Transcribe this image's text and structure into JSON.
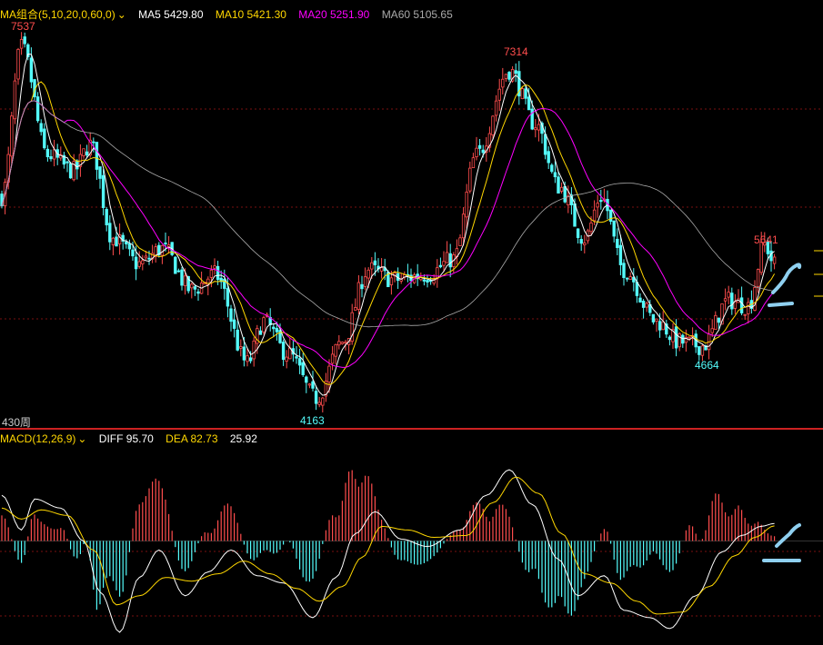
{
  "main_panel": {
    "ma_group_label": "MA组合(5,10,20,0,60,0)",
    "ma5_label": "MA5 5429.80",
    "ma10_label": "MA10 5421.30",
    "ma20_label": "MA20 5251.90",
    "ma60_label": "MA60 5105.65",
    "period_label": "430周",
    "annotations": {
      "high1": "7537",
      "low1": "4163",
      "high2": "7314",
      "low2": "4664",
      "recent_high": "5641"
    }
  },
  "macd_panel": {
    "macd_label": "MACD(12,26,9)",
    "diff_label": "DIFF 95.70",
    "dea_label": "DEA 82.73",
    "macd_value": "25.92"
  },
  "colors": {
    "ma5": "#ffffff",
    "ma10": "#ffd700",
    "ma20": "#ff00ff",
    "ma60": "#aaaaaa",
    "up": "#ff4d4d",
    "down": "#54fcfc",
    "annot_high": "#ff4d4d",
    "annot_low": "#54fcfc",
    "grid": "#7a1010",
    "freehand": "#8fd0f0"
  },
  "chart_data": {
    "type": "candlestick",
    "price_range": [
      4163,
      7537
    ],
    "anchors": [
      [
        0,
        6100
      ],
      [
        6,
        7537
      ],
      [
        14,
        6500
      ],
      [
        22,
        6350
      ],
      [
        27,
        6600
      ],
      [
        34,
        5700
      ],
      [
        42,
        5450
      ],
      [
        49,
        5600
      ],
      [
        58,
        5200
      ],
      [
        65,
        5350
      ],
      [
        75,
        4500
      ],
      [
        80,
        4900
      ],
      [
        87,
        4600
      ],
      [
        96,
        4163
      ],
      [
        104,
        4700
      ],
      [
        112,
        5400
      ],
      [
        120,
        5300
      ],
      [
        130,
        5350
      ],
      [
        138,
        5500
      ],
      [
        145,
        6500
      ],
      [
        155,
        7314
      ],
      [
        163,
        6800
      ],
      [
        170,
        6200
      ],
      [
        178,
        5700
      ],
      [
        183,
        6100
      ],
      [
        190,
        5400
      ],
      [
        200,
        4900
      ],
      [
        207,
        4700
      ],
      [
        214,
        4664
      ],
      [
        222,
        5100
      ],
      [
        228,
        5050
      ],
      [
        233,
        5641
      ],
      [
        236,
        5450
      ]
    ],
    "macd": {
      "diff": [
        [
          0,
          250
        ],
        [
          6,
          60
        ],
        [
          10,
          230
        ],
        [
          18,
          180
        ],
        [
          25,
          0
        ],
        [
          30,
          -280
        ],
        [
          36,
          -500
        ],
        [
          42,
          -200
        ],
        [
          48,
          -50
        ],
        [
          56,
          -300
        ],
        [
          63,
          -170
        ],
        [
          70,
          -50
        ],
        [
          78,
          -190
        ],
        [
          86,
          -230
        ],
        [
          95,
          -420
        ],
        [
          102,
          -200
        ],
        [
          108,
          40
        ],
        [
          114,
          160
        ],
        [
          122,
          10
        ],
        [
          130,
          -30
        ],
        [
          140,
          60
        ],
        [
          148,
          250
        ],
        [
          155,
          390
        ],
        [
          162,
          200
        ],
        [
          170,
          -100
        ],
        [
          176,
          -300
        ],
        [
          184,
          -190
        ],
        [
          190,
          -380
        ],
        [
          198,
          -420
        ],
        [
          204,
          -480
        ],
        [
          212,
          -300
        ],
        [
          220,
          -60
        ],
        [
          226,
          30
        ],
        [
          232,
          80
        ],
        [
          236,
          95.7
        ]
      ],
      "dea": [
        [
          0,
          180
        ],
        [
          6,
          120
        ],
        [
          12,
          170
        ],
        [
          20,
          140
        ],
        [
          28,
          -50
        ],
        [
          35,
          -350
        ],
        [
          42,
          -300
        ],
        [
          50,
          -200
        ],
        [
          58,
          -220
        ],
        [
          66,
          -180
        ],
        [
          74,
          -110
        ],
        [
          82,
          -180
        ],
        [
          90,
          -260
        ],
        [
          97,
          -330
        ],
        [
          104,
          -250
        ],
        [
          110,
          -90
        ],
        [
          116,
          80
        ],
        [
          124,
          60
        ],
        [
          132,
          20
        ],
        [
          142,
          30
        ],
        [
          150,
          210
        ],
        [
          157,
          350
        ],
        [
          164,
          260
        ],
        [
          171,
          40
        ],
        [
          178,
          -180
        ],
        [
          186,
          -230
        ],
        [
          194,
          -330
        ],
        [
          200,
          -400
        ],
        [
          208,
          -390
        ],
        [
          216,
          -250
        ],
        [
          224,
          -80
        ],
        [
          230,
          20
        ],
        [
          236,
          82.73
        ]
      ],
      "range": [
        -550,
        500
      ]
    }
  }
}
